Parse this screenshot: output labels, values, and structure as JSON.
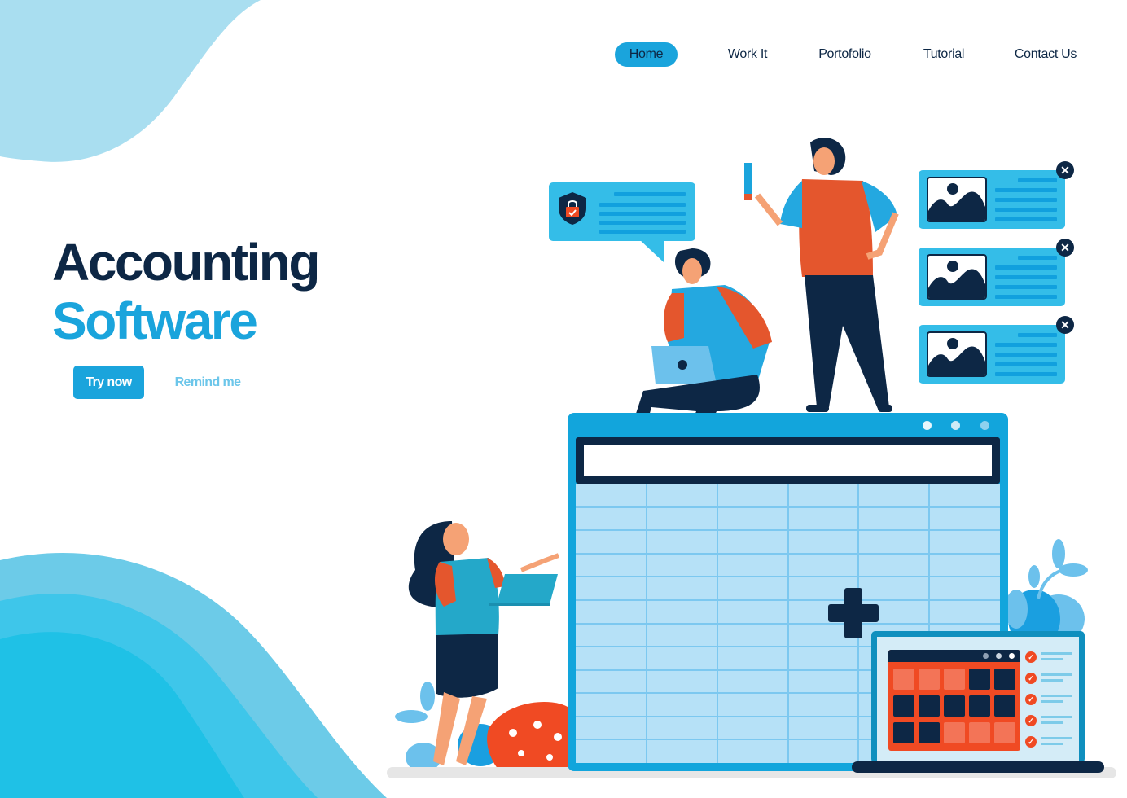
{
  "nav": {
    "items": [
      {
        "label": "Home",
        "active": true
      },
      {
        "label": "Work It",
        "active": false
      },
      {
        "label": "Portofolio",
        "active": false
      },
      {
        "label": "Tutorial",
        "active": false
      },
      {
        "label": "Contact Us",
        "active": false
      }
    ]
  },
  "hero": {
    "title_line1": "Accounting",
    "title_line2": "Software",
    "primary_button": "Try now",
    "secondary_button": "Remind me"
  },
  "illustration": {
    "spreadsheet": {
      "columns": 6,
      "rows": 12,
      "add_icon": "plus-icon"
    },
    "security_bubble": {
      "icon": "shield-lock-check-icon"
    },
    "image_cards": [
      {
        "icon": "image-icon",
        "close_icon": "close-icon",
        "close_glyph": "✕"
      },
      {
        "icon": "image-icon",
        "close_icon": "close-icon",
        "close_glyph": "✕"
      },
      {
        "icon": "image-icon",
        "close_icon": "close-icon",
        "close_glyph": "✕"
      }
    ],
    "calendar": {
      "grid": [
        [
          "light",
          "light",
          "light",
          "dark",
          "dark"
        ],
        [
          "dark",
          "dark",
          "dark",
          "dark",
          "dark"
        ],
        [
          "dark",
          "dark",
          "light",
          "light",
          "light"
        ]
      ],
      "checklist_count": 5,
      "check_glyph": "✓"
    }
  },
  "colors": {
    "primary": "#1aa4dc",
    "navy": "#0d2745",
    "accent_orange": "#f04a23",
    "light_blue": "#b6e1f7"
  }
}
